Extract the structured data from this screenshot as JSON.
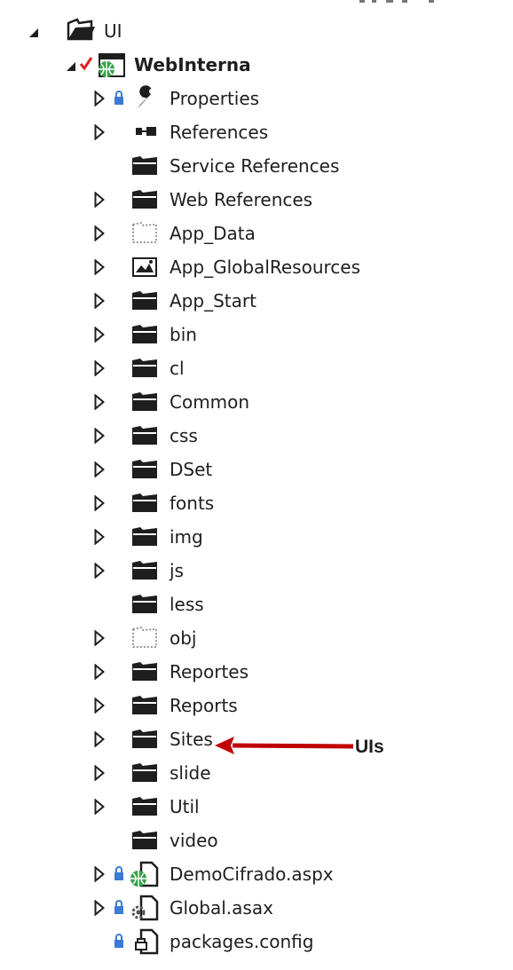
{
  "tree": {
    "root": {
      "label": "UI"
    },
    "project": {
      "label": "WebInterna"
    },
    "items": [
      {
        "label": "Properties",
        "expander": "collapsed",
        "icon": "properties-wrench-icon"
      },
      {
        "label": "References",
        "expander": "collapsed",
        "icon": "references-icon"
      },
      {
        "label": "Service References",
        "expander": "none",
        "icon": "folder-icon"
      },
      {
        "label": "Web References",
        "expander": "collapsed",
        "icon": "folder-icon"
      },
      {
        "label": "App_Data",
        "expander": "collapsed",
        "icon": "folder-dotted-icon"
      },
      {
        "label": "App_GlobalResources",
        "expander": "collapsed",
        "icon": "resource-folder-icon"
      },
      {
        "label": "App_Start",
        "expander": "collapsed",
        "icon": "folder-icon"
      },
      {
        "label": "bin",
        "expander": "collapsed",
        "icon": "folder-icon"
      },
      {
        "label": "cl",
        "expander": "collapsed",
        "icon": "folder-icon"
      },
      {
        "label": "Common",
        "expander": "collapsed",
        "icon": "folder-icon"
      },
      {
        "label": "css",
        "expander": "collapsed",
        "icon": "folder-icon"
      },
      {
        "label": "DSet",
        "expander": "collapsed",
        "icon": "folder-icon"
      },
      {
        "label": "fonts",
        "expander": "collapsed",
        "icon": "folder-icon"
      },
      {
        "label": "img",
        "expander": "collapsed",
        "icon": "folder-icon"
      },
      {
        "label": "js",
        "expander": "collapsed",
        "icon": "folder-icon"
      },
      {
        "label": "less",
        "expander": "none",
        "icon": "folder-icon"
      },
      {
        "label": "obj",
        "expander": "collapsed",
        "icon": "folder-dotted-icon"
      },
      {
        "label": "Reportes",
        "expander": "collapsed",
        "icon": "folder-icon"
      },
      {
        "label": "Reports",
        "expander": "collapsed",
        "icon": "folder-icon"
      },
      {
        "label": "Sites",
        "expander": "collapsed",
        "icon": "folder-icon"
      },
      {
        "label": "slide",
        "expander": "collapsed",
        "icon": "folder-icon"
      },
      {
        "label": "Util",
        "expander": "collapsed",
        "icon": "folder-icon"
      },
      {
        "label": "video",
        "expander": "none",
        "icon": "folder-icon"
      },
      {
        "label": "DemoCifrado.aspx",
        "expander": "collapsed",
        "icon": "aspx-file-icon"
      },
      {
        "label": "Global.asax",
        "expander": "collapsed",
        "icon": "asax-file-icon"
      },
      {
        "label": "packages.config",
        "expander": "none",
        "icon": "config-file-icon"
      }
    ]
  },
  "annotation": {
    "text": "UIs",
    "arrow_color": "#c00000"
  },
  "colors": {
    "folder": "#1e1e1e",
    "expander": "#1e1e1e",
    "checkmark": "#e02020",
    "lock": "#3a7bd5",
    "globe": "#3aa04a"
  }
}
